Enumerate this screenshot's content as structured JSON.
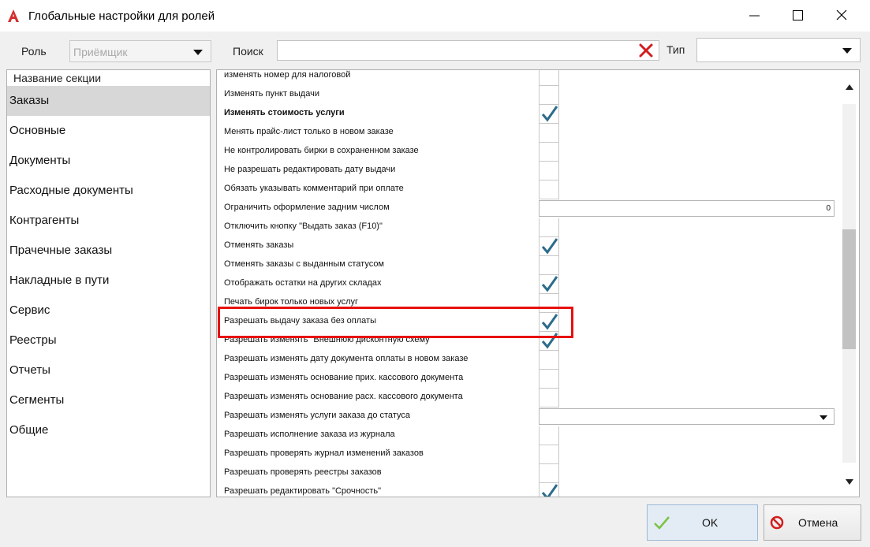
{
  "window": {
    "title": "Глобальные настройки для ролей"
  },
  "toolbar": {
    "role_label": "Роль",
    "role_value": "Приёмщик",
    "search_label": "Поиск",
    "search_value": "",
    "type_label": "Тип",
    "type_value": ""
  },
  "sections": {
    "header": "Название секции",
    "items": [
      {
        "label": "Заказы",
        "selected": true
      },
      {
        "label": "Основные"
      },
      {
        "label": "Документы"
      },
      {
        "label": "Расходные документы"
      },
      {
        "label": "Контрагенты"
      },
      {
        "label": "Прачечные заказы"
      },
      {
        "label": "Накладные в пути"
      },
      {
        "label": "Сервис"
      },
      {
        "label": "Реестры"
      },
      {
        "label": "Отчеты"
      },
      {
        "label": "Сегменты"
      },
      {
        "label": "Общие"
      }
    ]
  },
  "settings": [
    {
      "label": "изменять номер для налоговой",
      "type": "checkbox",
      "checked": false
    },
    {
      "label": "Изменять пункт выдачи",
      "type": "checkbox",
      "checked": false
    },
    {
      "label": "Изменять стоимость услуги",
      "type": "checkbox",
      "checked": true,
      "bold": true
    },
    {
      "label": "Менять прайс-лист только в новом заказе",
      "type": "checkbox",
      "checked": false
    },
    {
      "label": "Не контролировать бирки в сохраненном заказе",
      "type": "checkbox",
      "checked": false
    },
    {
      "label": "Не разрешать редактировать дату выдачи",
      "type": "checkbox",
      "checked": false
    },
    {
      "label": "Обязать указывать комментарий при оплате",
      "type": "checkbox",
      "checked": false
    },
    {
      "label": "Ограничить оформление задним числом",
      "type": "number",
      "value": "0"
    },
    {
      "label": "Отключить кнопку \"Выдать заказ (F10)\"",
      "type": "checkbox",
      "checked": false
    },
    {
      "label": "Отменять заказы",
      "type": "checkbox",
      "checked": true
    },
    {
      "label": "Отменять заказы с выданным статусом",
      "type": "checkbox",
      "checked": false
    },
    {
      "label": "Отображать остатки на других складах",
      "type": "checkbox",
      "checked": true
    },
    {
      "label": "Печать бирок только новых услуг",
      "type": "checkbox",
      "checked": false
    },
    {
      "label": "Разрешать выдачу заказа без оплаты",
      "type": "checkbox",
      "checked": true,
      "highlighted": true
    },
    {
      "label": "Разрешать изменять \"Внешнюю дисконтную схему\"",
      "type": "checkbox",
      "checked": true
    },
    {
      "label": "Разрешать изменять дату документа оплаты в новом заказе",
      "type": "checkbox",
      "checked": false
    },
    {
      "label": "Разрешать изменять основание прих. кассового документа",
      "type": "checkbox",
      "checked": false
    },
    {
      "label": "Разрешать изменять основание расх. кассового документа",
      "type": "checkbox",
      "checked": false
    },
    {
      "label": "Разрешать изменять услуги заказа до статуса",
      "type": "select",
      "value": ""
    },
    {
      "label": "Разрешать исполнение заказа из журнала",
      "type": "checkbox",
      "checked": false
    },
    {
      "label": "Разрешать проверять журнал изменений заказов",
      "type": "checkbox",
      "checked": false
    },
    {
      "label": "Разрешать проверять реестры заказов",
      "type": "checkbox",
      "checked": false
    },
    {
      "label": "Разрешать редактировать \"Срочность\"",
      "type": "checkbox",
      "checked": true
    }
  ],
  "buttons": {
    "ok_label": "OK",
    "cancel_label": "Отмена"
  },
  "colors": {
    "check": "#2b6c8c",
    "highlight": "#e81010",
    "ok_icon": "#7cc243",
    "cancel_icon": "#d21e1e",
    "logo": "#d32f2f"
  },
  "icons": {
    "app": "app-logo-icon",
    "clear": "clear-x-icon",
    "check": "checkmark-icon",
    "ok": "ok-check-icon",
    "cancel": "cancel-forbidden-icon"
  }
}
